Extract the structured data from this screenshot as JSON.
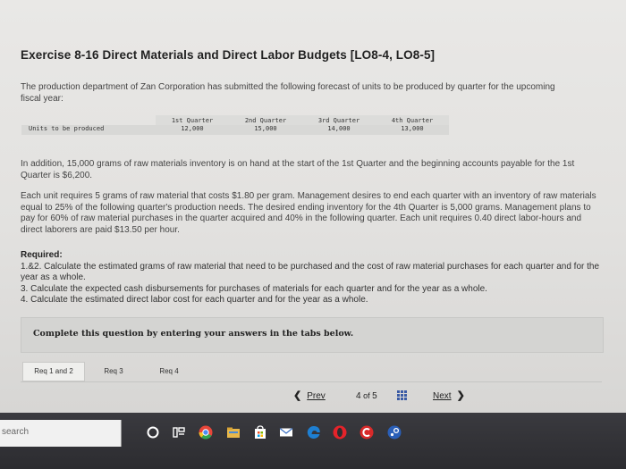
{
  "exercise": {
    "title": "Exercise 8-16 Direct Materials and Direct Labor Budgets [LO8-4, LO8-5]",
    "intro": "The production department of Zan Corporation has submitted the following forecast of units to be produced by quarter for the upcoming fiscal year:",
    "table": {
      "row_label": "Units to be produced",
      "columns": [
        "1st Quarter",
        "2nd Quarter",
        "3rd Quarter",
        "4th Quarter"
      ],
      "values": [
        "12,000",
        "15,000",
        "14,000",
        "13,000"
      ]
    },
    "para_inventory": "In addition, 15,000 grams of raw materials inventory is on hand at the start of the 1st Quarter and the beginning accounts payable for the 1st Quarter is $6,200.",
    "para_details": "Each unit requires 5 grams of raw material that costs $1.80 per gram. Management desires to end each quarter with an inventory of raw materials equal to 25% of the following quarter's production needs. The desired ending inventory for the 4th Quarter is 5,000 grams. Management plans to pay for 60% of raw material purchases in the quarter acquired and 40% in the following quarter. Each unit requires 0.40 direct labor-hours and direct laborers are paid $13.50 per hour.",
    "required": {
      "heading": "Required:",
      "items": [
        "1.&2. Calculate the estimated grams of raw material that need to be purchased and the cost of raw material purchases for each quarter and for the year as a whole.",
        "3. Calculate the expected cash disbursements for purchases of materials for each quarter and for the year as a whole.",
        "4. Calculate the estimated direct labor cost for each quarter and for the year as a whole."
      ]
    },
    "instruction": "Complete this question by entering your answers in the tabs below.",
    "tabs": [
      "Req 1 and 2",
      "Req 3",
      "Req 4"
    ]
  },
  "pager": {
    "prev": "Prev",
    "current": "4",
    "of_label": "of",
    "total": "5",
    "next": "Next"
  },
  "taskbar": {
    "search_placeholder": "search",
    "icons": [
      "cortana-icon",
      "task-view-icon",
      "chrome-icon",
      "file-explorer-icon",
      "store-icon",
      "mail-icon",
      "edge-icon",
      "opera-icon",
      "ccleaner-icon",
      "steam-icon"
    ]
  },
  "colors": {
    "screen_bg": "#e5e4e2",
    "taskbar_bg": "#2f2f33",
    "pager_grid": "#3b5ba5"
  }
}
